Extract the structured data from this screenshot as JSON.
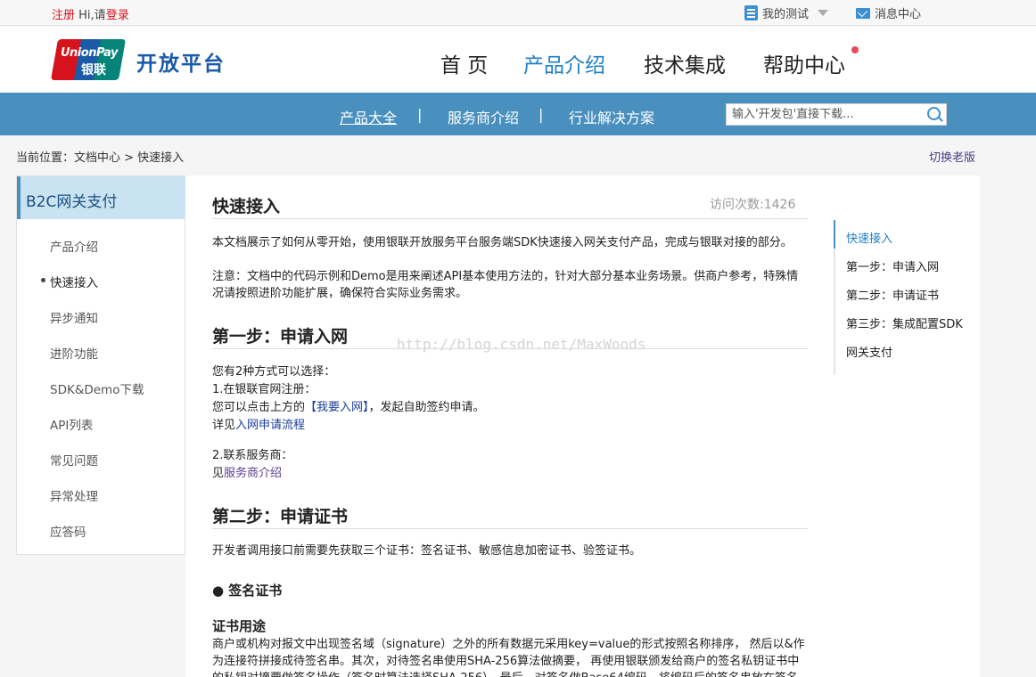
{
  "topbar": {
    "register": "注册",
    "greeting": "Hi,请",
    "login": "登录",
    "my_test": "我的测试",
    "messages": "消息中心"
  },
  "header": {
    "logo_text": "UnionPay",
    "logo_cn": "银联",
    "brand": "开放平台",
    "nav": [
      "首 页",
      "产品介绍",
      "技术集成",
      "帮助中心"
    ]
  },
  "subnav": {
    "items": [
      "产品大全",
      "服务商介绍",
      "行业解决方案"
    ],
    "separator": "|",
    "search_placeholder": "输入'开发包'直接下载..."
  },
  "breadcrumb": "当前位置：文档中心 > 快速接入",
  "switch_old": "切换老版",
  "sidebar": {
    "title": "B2C网关支付",
    "items": [
      "产品介绍",
      "快速接入",
      "异步通知",
      "进阶功能",
      "SDK&Demo下载",
      "API列表",
      "常见问题",
      "异常处理",
      "应答码"
    ],
    "current": "快速接入"
  },
  "article": {
    "title": "快速接入",
    "visits": "访问次数:1426",
    "intro1": "本文档展示了如何从零开始，使用银联开放服务平台服务端SDK快速接入网关支付产品，完成与银联对接的部分。",
    "intro2": "注意：文档中的代码示例和Demo是用来阐述API基本使用方法的，针对大部分基本业务场景。供商户参考，特殊情况请按照进阶功能扩展，确保符合实际业务需求。",
    "step1_title": "第一步：申请入网",
    "step1_line1": "您有2种方式可以选择：",
    "step1_line2": "1.在银联官网注册：",
    "step1_line3a": "您可以点击上方的",
    "step1_link": "【我要入网】",
    "step1_line3b": "，发起自助签约申请。",
    "step1_line4a": "详见",
    "step1_link2": "入网申请流程",
    "step1_line5": "2.联系服务商：",
    "step1_line6a": "见",
    "step1_link3": "服务商介绍",
    "step2_title": "第二步：申请证书",
    "step2_line1": "开发者调用接口前需要先获取三个证书：签名证书、敏感信息加密证书、验签证书。",
    "sign_cert": "● 签名证书",
    "usage_title": "证书用途",
    "usage_text": "商户或机构对报文中出现签名域（signature）之外的所有数据元采用key=value的形式按照名称排序， 然后以&作为连接符拼接成待签名串。其次，对待签名串使用SHA-256算法做摘要， 再使用银联颁发给商户的签名私钥证书中的私钥对摘要做签名操作（签名时算法选择SHA-256）。最后，对签名做Base64编码，将编码后的签名串放在签名（signature）表域域和请求报文一起发送给银联。",
    "watermark": "http://blog.csdn.net/MaxWoods"
  },
  "toc": [
    "快速接入",
    "第一步：申请入网",
    "第二步：申请证书",
    "第三步：集成配置SDK",
    "网关支付"
  ]
}
